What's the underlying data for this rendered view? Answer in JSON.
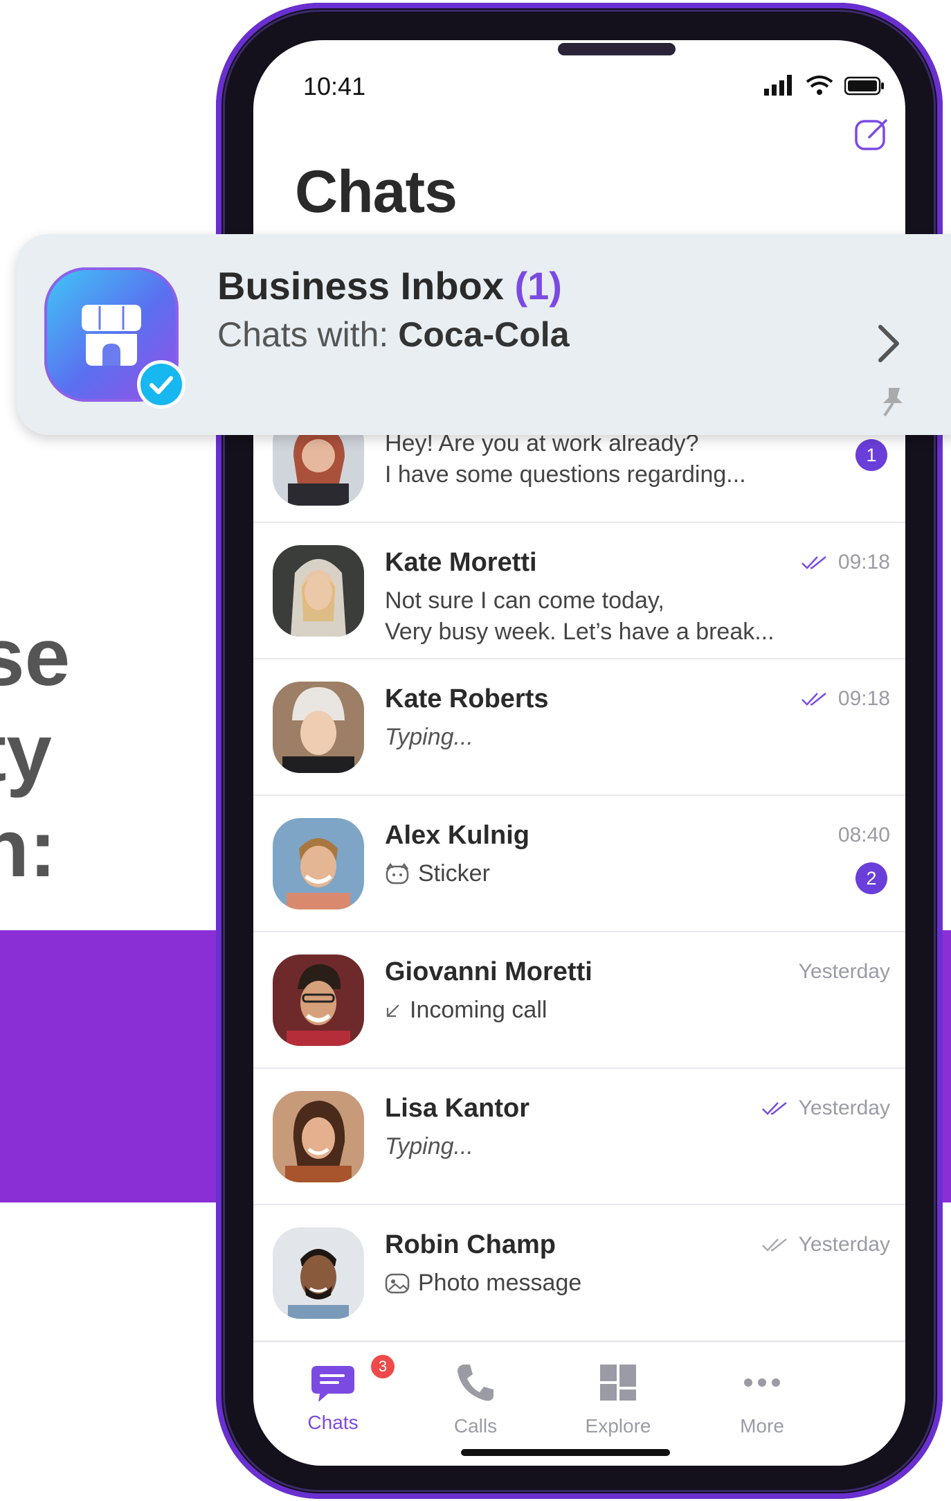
{
  "background": {
    "lines": [
      "se",
      "ty",
      "h:"
    ],
    "band_color": "#8a2fd6"
  },
  "status_bar": {
    "time": "10:41"
  },
  "header": {
    "title": "Chats",
    "compose_icon": "compose-icon"
  },
  "business_inbox": {
    "title": "Business Inbox",
    "count": "(1)",
    "subtitle_prefix": "Chats with:",
    "subtitle_business": "Coca-Cola"
  },
  "chats": [
    {
      "name": "",
      "message_line1": "Hey! Are you at work already?",
      "message_line2": "I have some questions regarding...",
      "time": "",
      "unread": "1"
    },
    {
      "name": "Kate Moretti",
      "message_line1": "Not sure I can come today,",
      "message_line2": "Very busy week. Let’s have a break...",
      "time": "09:18",
      "read": true
    },
    {
      "name": "Kate Roberts",
      "message_line1": "Typing...",
      "time": "09:18",
      "read": true
    },
    {
      "name": "Alex Kulnig",
      "message_line1": "Sticker",
      "time": "08:40",
      "unread": "2"
    },
    {
      "name": "Giovanni Moretti",
      "message_line1": "Incoming call",
      "time": "Yesterday"
    },
    {
      "name": "Lisa Kantor",
      "message_line1": "Typing...",
      "time": "Yesterday",
      "read": true
    },
    {
      "name": "Robin Champ",
      "message_line1": "Photo message",
      "time": "Yesterday",
      "read": true
    }
  ],
  "tabbar": {
    "tabs": [
      {
        "label": "Chats",
        "badge": "3",
        "active": true
      },
      {
        "label": "Calls"
      },
      {
        "label": "Explore"
      },
      {
        "label": "More"
      }
    ]
  },
  "colors": {
    "accent": "#7b4ae2",
    "badge_red": "#ef4a4a",
    "biz_card_bg": "#e8eef1"
  }
}
